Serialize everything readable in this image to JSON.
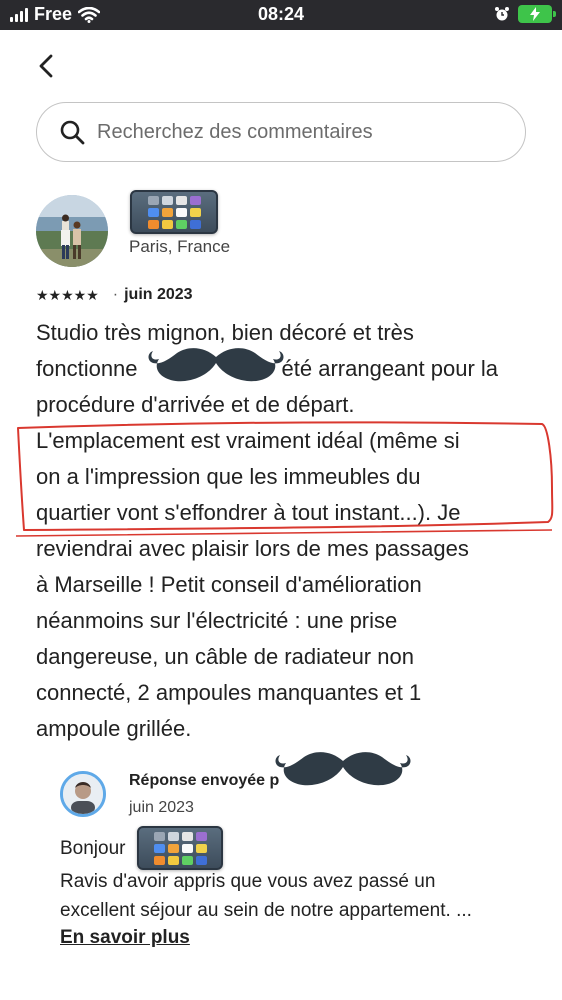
{
  "status_bar": {
    "carrier": "Free",
    "time": "08:24"
  },
  "search": {
    "placeholder": "Recherchez des commentaires"
  },
  "review": {
    "location": "Paris, France",
    "stars": "★★★★★",
    "rating": 5,
    "date": "juin 2023",
    "lines": [
      "Studio très mignon, bien décoré et très",
      "fonctionne",
      "été arrangeant pour la",
      "procédure d'arrivée et de départ.",
      "L'emplacement est vraiment idéal (même si",
      "on a l'impression que les immeubles du",
      "quartier vont s'effondrer à tout instant...). Je",
      "reviendrai avec plaisir lors de mes passages",
      "à Marseille ! Petit conseil d'amélioration",
      "néanmoins sur l'électricité : une prise",
      "dangereuse, un câble de radiateur non",
      "connecté, 2 ampoules manquantes et 1",
      "ampoule grillée."
    ]
  },
  "response": {
    "title": "Réponse envoyée p",
    "date": "juin 2023",
    "greeting": "Bonjour",
    "lines": [
      "Ravis d'avoir appris que vous avez passé un",
      "excellent séjour au sein de notre appartement. ..."
    ],
    "read_more": "En savoir plus"
  },
  "colors": {
    "status_bar_bg": "#2a2a2e",
    "battery": "#3ec44a",
    "annotation_red": "#d9382f",
    "text": "#222222"
  }
}
